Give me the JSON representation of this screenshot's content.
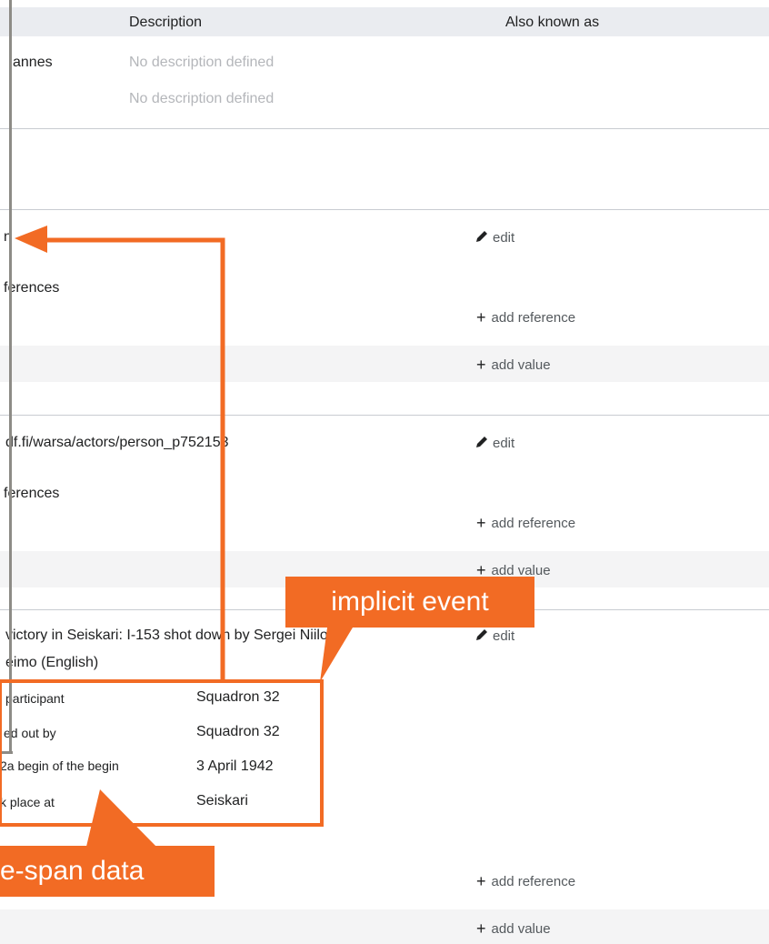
{
  "header": {
    "description": "Description",
    "also_known_as": "Also known as"
  },
  "labels_rows": [
    {
      "label_fragment": "annes",
      "description": "No description defined"
    },
    {
      "description": "No description defined"
    }
  ],
  "statements": [
    {
      "value_fragment": "n",
      "edit_label": "edit",
      "references_fragment": "ferences",
      "add_reference": "add reference",
      "add_value": "add value"
    },
    {
      "value_fragment": "df.fi/warsa/actors/person_p752153",
      "edit_label": "edit",
      "references_fragment": "ferences",
      "add_reference": "add reference",
      "add_value": "add value"
    },
    {
      "value_line1": "victory in Seiskari: I-153 shot down by Sergei Niilo",
      "value_line2": "eimo (English)",
      "edit_label": "edit",
      "qualifiers": [
        {
          "property": "participant",
          "value": "Squadron 32"
        },
        {
          "property": "ed out by",
          "value": "Squadron 32"
        },
        {
          "property": "2a begin of the begin",
          "value": "3 April 1942"
        },
        {
          "property": "k place at",
          "value": "Seiskari"
        }
      ],
      "add_reference": "add reference",
      "add_value": "add value"
    }
  ],
  "annotations": {
    "implicit_event": "implicit event",
    "time_span_data": "e-span data"
  },
  "colors": {
    "accent": "#f26b24",
    "bar": "#8d8b86",
    "header_bg": "#eaecf0",
    "row_bg": "#f4f4f5"
  }
}
